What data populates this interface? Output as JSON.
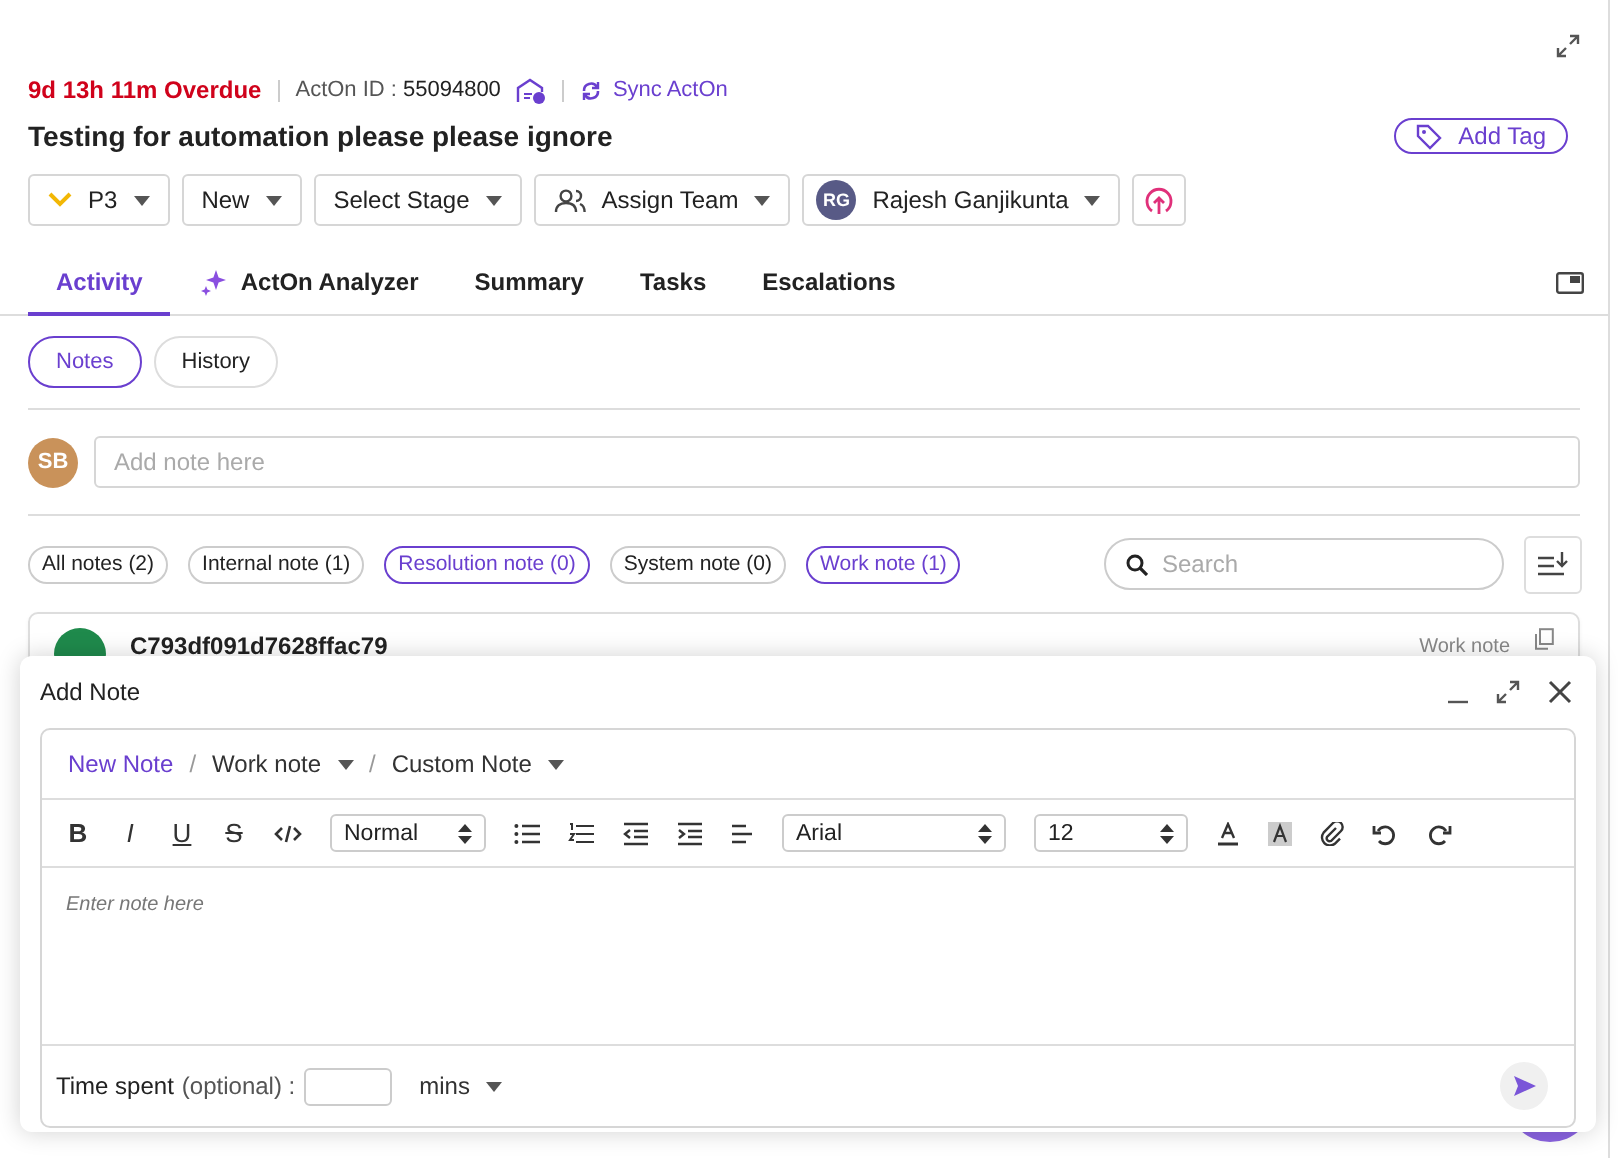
{
  "overdue": "9d 13h 11m Overdue",
  "acton_id": {
    "label": "ActOn ID :",
    "value": "55094800"
  },
  "sync_link": "Sync ActOn",
  "title": "Testing for automation please please ignore",
  "add_tag": "Add Tag",
  "dropdowns": [
    {
      "kind": "priority",
      "label": "P3"
    },
    {
      "kind": "plain",
      "label": "New"
    },
    {
      "kind": "plain",
      "label": "Select Stage"
    },
    {
      "kind": "team",
      "label": "Assign Team"
    },
    {
      "kind": "user",
      "label": "Rajesh Ganjikunta",
      "initials": "RG"
    }
  ],
  "tabs": [
    {
      "kind": "text",
      "label": "Activity",
      "selected": true
    },
    {
      "kind": "ai",
      "label": "ActOn Analyzer",
      "selected": false
    },
    {
      "kind": "text",
      "label": "Summary",
      "selected": false
    },
    {
      "kind": "text",
      "label": "Tasks",
      "selected": false
    },
    {
      "kind": "text",
      "label": "Escalations",
      "selected": false
    }
  ],
  "subtabs": [
    {
      "label": "Notes",
      "selected": true
    },
    {
      "label": "History",
      "selected": false
    }
  ],
  "note_input": {
    "initials": "SB",
    "placeholder": "Add note here"
  },
  "filters": [
    {
      "label": "All notes (2)",
      "selected": false
    },
    {
      "label": "Internal note (1)",
      "selected": false
    },
    {
      "label": "Resolution note (0)",
      "selected": true
    },
    {
      "label": "System note (0)",
      "selected": false
    },
    {
      "label": "Work note (1)",
      "selected": true
    }
  ],
  "search": {
    "placeholder": "Search"
  },
  "note": {
    "id": "C793df091d7628ffac79",
    "type": "Work note"
  },
  "modal": {
    "title": "Add Note",
    "breadcrumb": [
      {
        "kind": "link",
        "label": "New Note"
      },
      {
        "kind": "menu",
        "label": "Work note"
      },
      {
        "kind": "menu",
        "label": "Custom Note"
      }
    ],
    "separators": [
      "/",
      "/"
    ],
    "format_buttons": [
      {
        "kind": "bold",
        "text": "B"
      },
      {
        "kind": "italic",
        "text": "I"
      },
      {
        "kind": "underline",
        "text": "U"
      },
      {
        "kind": "strike",
        "text": "S"
      }
    ],
    "heading_select": "Normal",
    "font_select": "Arial",
    "size_select": "12",
    "placeholder": "Enter note here",
    "time_label": "Time spent",
    "time_optional": "(optional) :",
    "unit": "mins"
  }
}
